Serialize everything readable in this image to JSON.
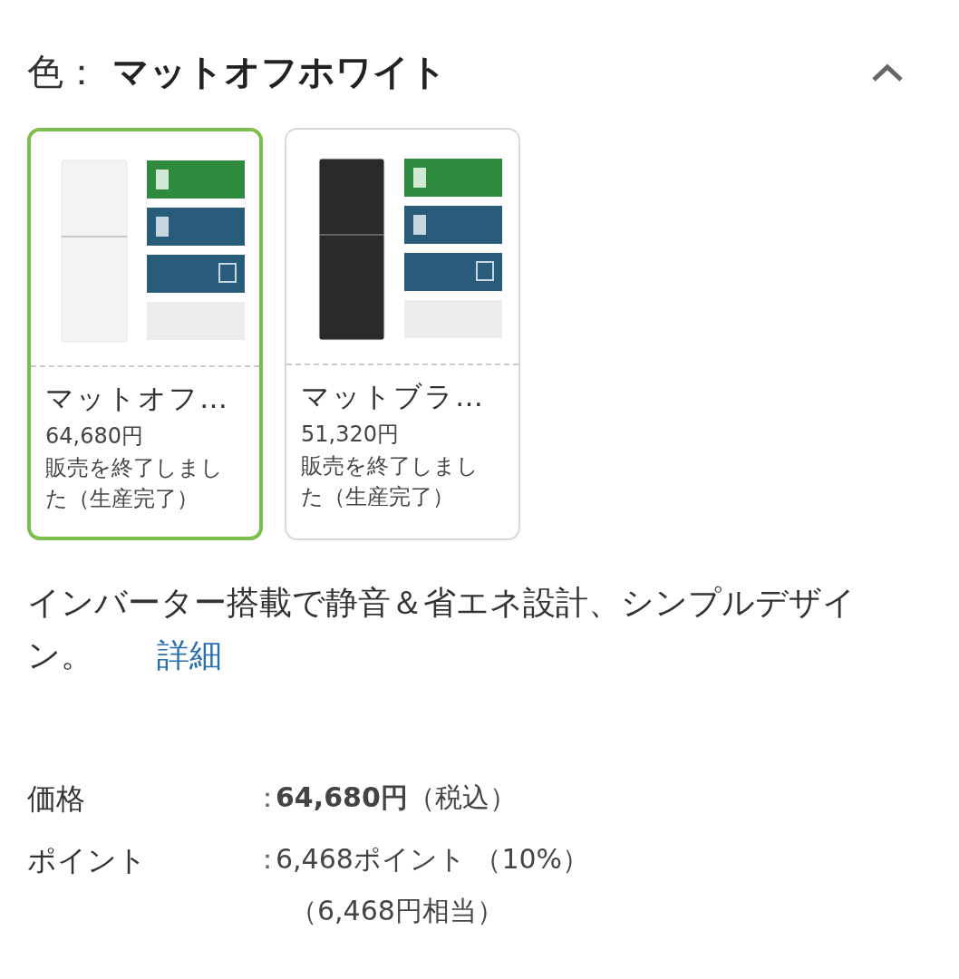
{
  "color_header": {
    "label": "色：",
    "value": "マットオフホワイト",
    "expanded": true
  },
  "variants": [
    {
      "kind": "picture",
      "color": "#f4f4f4",
      "name": "マットオフ…",
      "price": "64,680円",
      "status": "販売を終了しました（生産完了）",
      "selected": true
    },
    {
      "kind": "picture",
      "color": "#2a2a2a",
      "name": "マットブラ…",
      "price": "51,320円",
      "status": "販売を終了しました（生産完了）",
      "selected": false
    }
  ],
  "description": {
    "text": "インバーター搭載で静音＆省エネ設計、シンプルデザイン。",
    "link": "詳細"
  },
  "specs": [
    {
      "label": "価格",
      "separator": "：",
      "lines": [
        "**64,680円**（税込）"
      ]
    },
    {
      "label": "ポイント",
      "separator": "：",
      "lines": [
        "6,468ポイント （10%）",
        "（6,468円相当）"
      ]
    }
  ]
}
